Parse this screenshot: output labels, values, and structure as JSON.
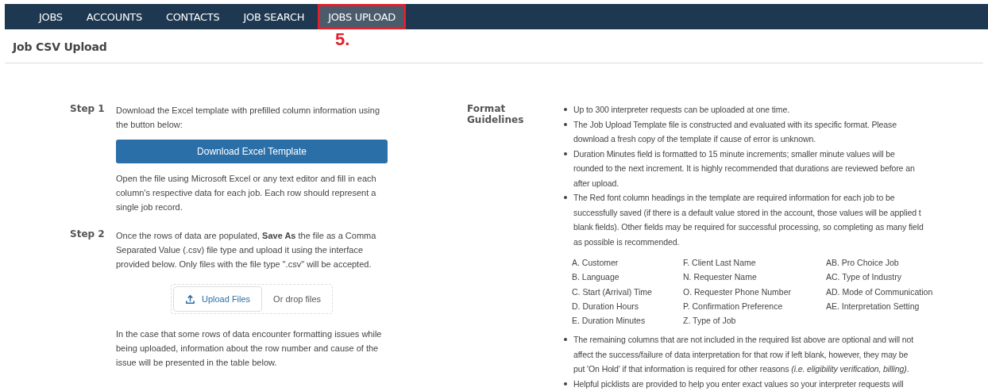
{
  "nav": {
    "items": [
      {
        "label": "JOBS",
        "selected": false
      },
      {
        "label": "ACCOUNTS",
        "selected": false
      },
      {
        "label": "CONTACTS",
        "selected": false
      },
      {
        "label": "JOB SEARCH",
        "selected": false
      },
      {
        "label": "JOBS UPLOAD",
        "selected": true
      }
    ]
  },
  "annotation": "5.",
  "page_title": "Job CSV Upload",
  "steps": [
    {
      "label": "Step 1",
      "parts": [
        {
          "kind": "text",
          "text": "Download the Excel template with prefilled column information using the button below:"
        },
        {
          "kind": "button",
          "text": "Download Excel Template"
        },
        {
          "kind": "text",
          "text": "Open the file using Microsoft Excel or any text editor and fill in each column's respective data for each job. Each row should represent a single job record."
        }
      ]
    },
    {
      "label": "Step 2",
      "parts": [
        {
          "kind": "text",
          "text": "Once the rows of data are populated, **Save As** the file as a Comma Separated Value (.csv) file type and upload it using the interface provided below. Only files with the file type \".csv\" will be accepted."
        },
        {
          "kind": "upload",
          "text": "Upload Files",
          "hint": "Or drop files"
        },
        {
          "kind": "text",
          "text": "In the case that some rows of data encounter formatting issues while being uploaded, information about the row number and cause of the issue will be presented in the table below."
        }
      ]
    }
  ],
  "guidelines": {
    "label": "Format Guidelines",
    "bullets": [
      {
        "lines": [
          "Up to 300 interpreter requests can be uploaded at one time."
        ]
      },
      {
        "lines": [
          "The Job Upload Template file is constructed and evaluated with its specific format. Please",
          "download a fresh copy of the template if cause of error is unknown."
        ]
      },
      {
        "lines": [
          "Duration Minutes field is formatted to 15 minute increments; smaller minute values will be",
          "rounded to the next increment. It is highly recommended that durations are reviewed before an",
          "after upload."
        ]
      },
      {
        "lines": [
          "The Red font column headings in the template are required information for each job to be",
          "successfully saved (if there is a default value stored in the account, those values will be applied t",
          "blank fields). Other fields may be required for successful processing, so completing as many field",
          "as possible is recommended."
        ],
        "required_columns": [
          [
            "A. Customer",
            "B. Language",
            "C. Start (Arrival) Time",
            "D. Duration Hours",
            "E. Duration Minutes"
          ],
          [
            "F. Client Last Name",
            "N. Requester Name",
            "O. Requester Phone Number",
            "P. Confirmation Preference",
            "Z. Type of Job"
          ],
          [
            "AB. Pro Choice Job",
            "AC. Type of Industry",
            "AD. Mode of Communication",
            "AE. Interpretation Setting"
          ]
        ]
      },
      {
        "lines": [
          "The remaining columns that are not included in the required list above are optional and will not",
          "affect the success/failure of data interpretation for that row if left blank, however, they may be",
          "put 'On Hold' if that information is required for other reasons *(i.e. eligibility verification, billing)*."
        ]
      },
      {
        "lines": [
          "Helpful picklists are provided to help you enter exact values so your interpreter requests will"
        ]
      }
    ]
  }
}
